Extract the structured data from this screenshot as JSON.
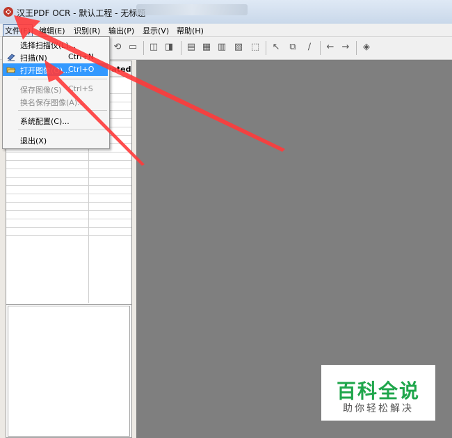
{
  "window": {
    "title": "汉王PDF OCR - 默认工程 - 无标题"
  },
  "menubar": {
    "items": [
      "文件(F)",
      "编辑(E)",
      "识别(R)",
      "输出(P)",
      "显示(V)",
      "帮助(H)"
    ],
    "active": "文件(F)"
  },
  "file_menu": {
    "items": [
      {
        "label": "选择扫描仪(L)...",
        "shortcut": "",
        "state": "normal"
      },
      {
        "label": "扫描(N)",
        "shortcut": "Ctrl+N",
        "state": "normal"
      },
      {
        "label": "打开图像(O)...",
        "shortcut": "Ctrl+O",
        "state": "highlighted"
      },
      {
        "label": "保存图像(S)",
        "shortcut": "Ctrl+S",
        "state": "disabled"
      },
      {
        "label": "换名保存图像(A)...",
        "shortcut": "",
        "state": "disabled"
      },
      {
        "label": "系统配置(C)...",
        "shortcut": "",
        "state": "normal"
      },
      {
        "label": "退出(X)",
        "shortcut": "",
        "state": "normal"
      }
    ]
  },
  "left_panel": {
    "column_header": "rated"
  },
  "watermark": {
    "main": "百科全说",
    "sub": "助你轻松解决"
  },
  "colors": {
    "canvas": "#7f7f7f",
    "highlight": "#3399ff",
    "annotation_arrow": "#ff3b3b",
    "watermark_green": "#1fa64b"
  },
  "icons": [
    "app-logo-icon",
    "scan-icon",
    "open-folder-icon",
    "arrow-left-icon",
    "arrow-right-icon"
  ]
}
